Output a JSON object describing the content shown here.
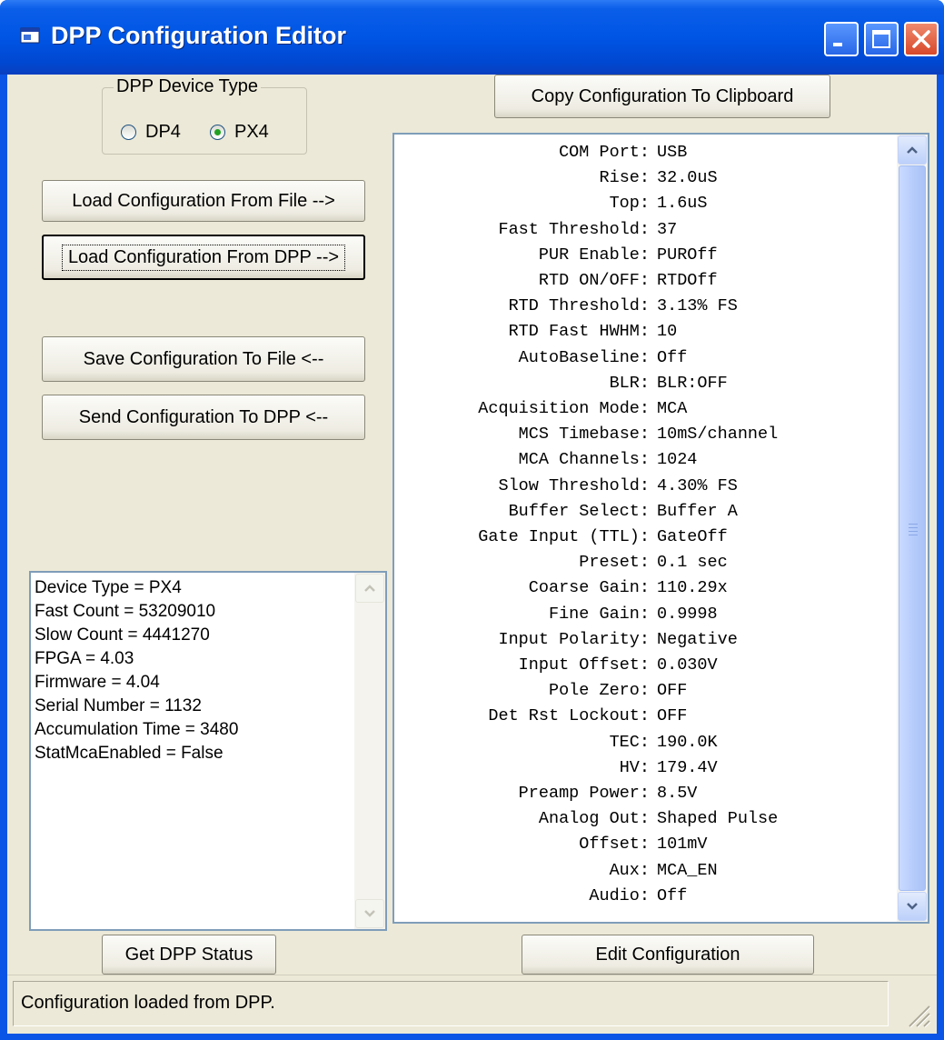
{
  "window": {
    "title": "DPP Configuration Editor"
  },
  "device_type": {
    "group_label": "DPP Device Type",
    "options": [
      {
        "label": "DP4",
        "checked": false
      },
      {
        "label": "PX4",
        "checked": true
      }
    ]
  },
  "buttons": {
    "copy_clipboard": "Copy Configuration To Clipboard",
    "load_from_file": "Load Configuration From File -->",
    "load_from_dpp": "Load Configuration From DPP -->",
    "save_to_file": "Save Configuration To File <--",
    "send_to_dpp": "Send Configuration To DPP <--",
    "get_status": "Get DPP Status",
    "edit_config": "Edit Configuration"
  },
  "status_list": [
    "Device Type = PX4",
    "Fast Count = 53209010",
    "Slow Count = 4441270",
    "FPGA = 4.03",
    "Firmware = 4.04",
    "Serial Number = 1132",
    "Accumulation Time = 3480",
    "StatMcaEnabled = False"
  ],
  "config": [
    {
      "label": "COM Port:",
      "value": "USB"
    },
    {
      "label": "Rise:",
      "value": "32.0uS"
    },
    {
      "label": "Top:",
      "value": "1.6uS"
    },
    {
      "label": "Fast Threshold:",
      "value": "37"
    },
    {
      "label": "PUR Enable:",
      "value": "PUROff"
    },
    {
      "label": "RTD ON/OFF:",
      "value": "RTDOff"
    },
    {
      "label": "RTD Threshold:",
      "value": "3.13% FS"
    },
    {
      "label": "RTD Fast HWHM:",
      "value": "10"
    },
    {
      "label": "AutoBaseline:",
      "value": "Off"
    },
    {
      "label": "BLR:",
      "value": "BLR:OFF"
    },
    {
      "label": "Acquisition Mode:",
      "value": "MCA"
    },
    {
      "label": "MCS Timebase:",
      "value": "10mS/channel"
    },
    {
      "label": "MCA Channels:",
      "value": "1024"
    },
    {
      "label": "Slow Threshold:",
      "value": "4.30% FS"
    },
    {
      "label": "Buffer Select:",
      "value": "Buffer A"
    },
    {
      "label": "Gate Input (TTL):",
      "value": "GateOff"
    },
    {
      "label": "Preset:",
      "value": "0.1 sec"
    },
    {
      "label": "Coarse Gain:",
      "value": "110.29x"
    },
    {
      "label": "Fine Gain:",
      "value": "0.9998"
    },
    {
      "label": "Input Polarity:",
      "value": "Negative"
    },
    {
      "label": "Input Offset:",
      "value": "0.030V"
    },
    {
      "label": "Pole Zero:",
      "value": "OFF"
    },
    {
      "label": "Det Rst Lockout:",
      "value": "OFF"
    },
    {
      "label": "TEC:",
      "value": "190.0K"
    },
    {
      "label": "HV:",
      "value": "179.4V"
    },
    {
      "label": "Preamp Power:",
      "value": "8.5V"
    },
    {
      "label": "Analog Out:",
      "value": "Shaped Pulse"
    },
    {
      "label": "Offset:",
      "value": "101mV"
    },
    {
      "label": "Aux:",
      "value": "MCA_EN"
    },
    {
      "label": "Audio:",
      "value": "Off"
    }
  ],
  "statusbar": {
    "text": "Configuration loaded from DPP."
  },
  "icons": {
    "app": "app-window-icon",
    "minimize": "minimize-icon",
    "maximize": "maximize-icon",
    "close": "close-icon"
  },
  "colors": {
    "titlebar": "#0055e5",
    "close_button": "#d8482a",
    "face": "#ece9d8"
  }
}
